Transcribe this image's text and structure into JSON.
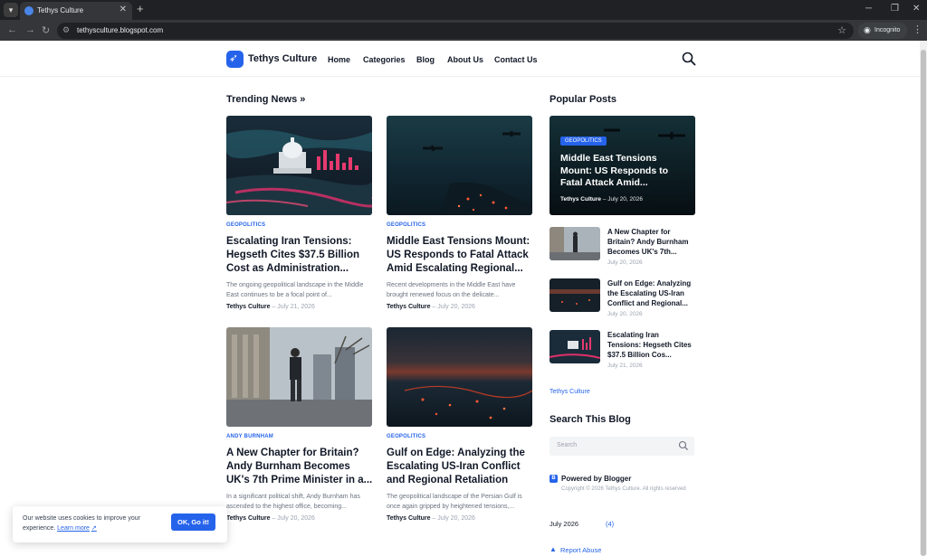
{
  "browser": {
    "tab_title": "Tethys Culture",
    "url": "tethysculture.blogspot.com",
    "incognito_label": "Incognito"
  },
  "site": {
    "logo_text": "Tethys Culture",
    "menu": [
      "Home",
      "Categories",
      "Blog",
      "About Us",
      "Contact Us"
    ]
  },
  "trending": {
    "heading": "Trending News »",
    "cards": [
      {
        "tag": "GEOPOLITICS",
        "title": "Escalating Iran Tensions: Hegseth Cites $37.5 Billion Cost as Administration...",
        "excerpt": "The ongoing geopolitical landscape in the Middle East continues to be a focal point of...",
        "author": "Tethys Culture",
        "date": "July 21, 2026"
      },
      {
        "tag": "GEOPOLITICS",
        "title": "Middle East Tensions Mount: US Responds to Fatal Attack Amid Escalating Regional...",
        "excerpt": "Recent developments in the Middle East have brought renewed focus on the delicate...",
        "author": "Tethys Culture",
        "date": "July 20, 2026"
      },
      {
        "tag": "ANDY BURNHAM",
        "title": "A New Chapter for Britain? Andy Burnham Becomes UK's 7th Prime Minister in a...",
        "excerpt": "In a significant political shift, Andy Burnham has ascended to the highest office, becoming...",
        "author": "Tethys Culture",
        "date": "July 20, 2026"
      },
      {
        "tag": "GEOPOLITICS",
        "title": "Gulf on Edge: Analyzing the Escalating US-Iran Conflict and Regional Retaliation",
        "excerpt": "The geopolitical landscape of the Persian Gulf is once again gripped by heightened tensions,...",
        "author": "Tethys Culture",
        "date": "July 20, 2026"
      }
    ]
  },
  "sidebar": {
    "popular_heading": "Popular Posts",
    "featured": {
      "tag": "GEOPOLITICS",
      "title": "Middle East Tensions Mount: US Responds to Fatal Attack Amid...",
      "author": "Tethys Culture",
      "date": "July 20, 2026"
    },
    "posts": [
      {
        "title": "A New Chapter for Britain? Andy Burnham Becomes UK's 7th...",
        "date": "July 20, 2026"
      },
      {
        "title": "Gulf on Edge: Analyzing the Escalating US-Iran Conflict and Regional...",
        "date": "July 20, 2026"
      },
      {
        "title": "Escalating Iran Tensions: Hegseth Cites $37.5 Billion Cos...",
        "date": "July 21, 2026"
      }
    ],
    "blog_link": "Tethys Culture",
    "search_heading": "Search This Blog",
    "search_placeholder": "Search",
    "powered_by": "Powered by Blogger",
    "copyright": "Copyright © 2026 Tethys Culture. All rights reserved",
    "archive_month": "July 2026",
    "archive_count": "(4)",
    "report_abuse": "Report Abuse"
  },
  "cookie": {
    "text": "Our website uses cookies to improve your experience.",
    "link": "Learn more",
    "button": "OK, Go it!"
  },
  "colors": {
    "accent": "#2563eb",
    "text": "#111827",
    "muted": "#6b7280"
  }
}
